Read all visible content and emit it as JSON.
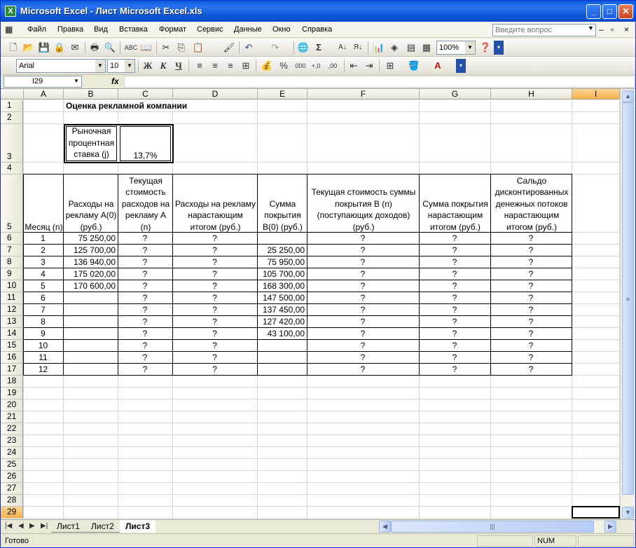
{
  "window": {
    "title": "Microsoft Excel - Лист Microsoft Excel.xls",
    "app_icon": "X"
  },
  "menu": {
    "items": [
      "Файл",
      "Правка",
      "Вид",
      "Вставка",
      "Формат",
      "Сервис",
      "Данные",
      "Окно",
      "Справка"
    ],
    "ask_placeholder": "Введите вопрос"
  },
  "toolbar": {
    "zoom": "100%",
    "sigma": "Σ"
  },
  "format_toolbar": {
    "font": "Arial",
    "size": "10",
    "bold": "Ж",
    "italic": "К",
    "underline": "Ч",
    "percent": "%",
    "thousands": "000"
  },
  "formula_bar": {
    "name_box": "I29",
    "fx": "fx",
    "value": ""
  },
  "columns": [
    "A",
    "B",
    "C",
    "D",
    "E",
    "F",
    "G",
    "H",
    "I"
  ],
  "rows": [
    "1",
    "2",
    "3",
    "4",
    "5",
    "6",
    "7",
    "8",
    "9",
    "10",
    "11",
    "12",
    "13",
    "14",
    "15",
    "16",
    "17",
    "18",
    "19",
    "20",
    "21",
    "22",
    "23",
    "24",
    "25",
    "26",
    "27",
    "28",
    "29"
  ],
  "sheet": {
    "title": "Оценка рекламной компании",
    "rate_label": "Рыночная процентная ставка (j)",
    "rate_value": "13,7%",
    "headers": [
      "Месяц (n)",
      "Расходы на рекламу А(0) (руб.)",
      "Текущая стоимость расходов на рекламу А (n)",
      "Расходы на рекламу нарастающим итогом (руб.)",
      "Сумма покрытия В(0) (руб.)",
      "Текущая стоимость суммы покрытия В (n) (поступающих доходов) (руб.)",
      "Сумма покрытия нарастающим итогом (руб.)",
      "Сальдо дисконтированных денежных потоков нарастающим итогом (руб.)"
    ],
    "data": [
      [
        "1",
        "75 250,00",
        "?",
        "?",
        "",
        "?",
        "?",
        "?"
      ],
      [
        "2",
        "125 700,00",
        "?",
        "?",
        "25 250,00",
        "?",
        "?",
        "?"
      ],
      [
        "3",
        "136 940,00",
        "?",
        "?",
        "75 950,00",
        "?",
        "?",
        "?"
      ],
      [
        "4",
        "175 020,00",
        "?",
        "?",
        "105 700,00",
        "?",
        "?",
        "?"
      ],
      [
        "5",
        "170 600,00",
        "?",
        "?",
        "168 300,00",
        "?",
        "?",
        "?"
      ],
      [
        "6",
        "",
        "?",
        "?",
        "147 500,00",
        "?",
        "?",
        "?"
      ],
      [
        "7",
        "",
        "?",
        "?",
        "137 450,00",
        "?",
        "?",
        "?"
      ],
      [
        "8",
        "",
        "?",
        "?",
        "127 420,00",
        "?",
        "?",
        "?"
      ],
      [
        "9",
        "",
        "?",
        "?",
        "43 100,00",
        "?",
        "?",
        "?"
      ],
      [
        "10",
        "",
        "?",
        "?",
        "",
        "?",
        "?",
        "?"
      ],
      [
        "11",
        "",
        "?",
        "?",
        "",
        "?",
        "?",
        "?"
      ],
      [
        "12",
        "",
        "?",
        "?",
        "",
        "?",
        "?",
        "?"
      ]
    ]
  },
  "tabs": [
    "Лист1",
    "Лист2",
    "Лист3"
  ],
  "active_tab": "Лист3",
  "status": {
    "ready": "Готово",
    "num": "NUM"
  },
  "colors": {
    "title_bar": "#0a5bdb",
    "selection": "#f7b24a"
  }
}
